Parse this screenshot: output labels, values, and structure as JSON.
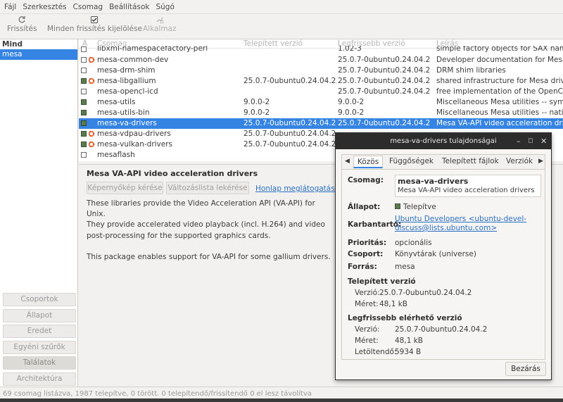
{
  "menubar": [
    "Fájl",
    "Szerkesztés",
    "Csomag",
    "Beállítások",
    "Súgó"
  ],
  "toolbar": {
    "refresh": "Frissítés",
    "mark_all": "Minden frissítés kijelölése",
    "apply": "Alkalmaz"
  },
  "sidebar": {
    "header": "Mind",
    "selected": "mesa",
    "buttons": [
      "Csoportok",
      "Állapot",
      "Eredet",
      "Egyéni szűrők",
      "Találatok",
      "Architektúra"
    ]
  },
  "table": {
    "headers": [
      "Á",
      "Csomag",
      "Telepített verzió",
      "Legfrissebb verzió",
      "Leírás"
    ],
    "rows": [
      {
        "name": "libxml-namespacefactory-perl",
        "installed": "",
        "latest": "1.02-3",
        "desc": "simple factory objects for SAX namespace"
      },
      {
        "name": "mesa-common-dev",
        "installed": "",
        "latest": "25.0.7-0ubuntu0.24.04.2",
        "desc": "Developer documentation for Mesa"
      },
      {
        "name": "mesa-drm-shim",
        "installed": "",
        "latest": "25.0.7-0ubuntu0.24.04.2",
        "desc": "DRM shim libraries"
      },
      {
        "name": "mesa-libgallium",
        "installed": "25.0.7-0ubuntu0.24.04.2",
        "latest": "25.0.7-0ubuntu0.24.04.2",
        "desc": "shared infrastructure for Mesa drivers"
      },
      {
        "name": "mesa-opencl-icd",
        "installed": "",
        "latest": "25.0.7-0ubuntu0.24.04.2",
        "desc": "free implementation of the OpenCL API"
      },
      {
        "name": "mesa-utils",
        "installed": "9.0.0-2",
        "latest": "9.0.0-2",
        "desc": "Miscellaneous Mesa utilities -- symlinks"
      },
      {
        "name": "mesa-utils-bin",
        "installed": "9.0.0-2",
        "latest": "9.0.0-2",
        "desc": "Miscellaneous Mesa utilities -- native app"
      },
      {
        "name": "mesa-va-drivers",
        "installed": "25.0.7-0ubuntu0.24.04.2",
        "latest": "25.0.7-0ubuntu0.24.04.2",
        "desc": "Mesa VA-API video acceleration drivers"
      },
      {
        "name": "mesa-vdpau-drivers",
        "installed": "25.0.7-0ubuntu0.24.04.2",
        "latest": "",
        "desc": ""
      },
      {
        "name": "mesa-vulkan-drivers",
        "installed": "25.0.7-0ubuntu0.24.04.2",
        "latest": "",
        "desc": ""
      },
      {
        "name": "mesaflash",
        "installed": "",
        "latest": "",
        "desc": ""
      }
    ]
  },
  "details": {
    "title": "Mesa VA-API video acceleration drivers",
    "btn_screenshot": "Képernyőkép kérése",
    "btn_changelog": "Változáslista lekérése",
    "homepage": "Honlap meglátogatása",
    "text1": "These libraries provide the Video Acceleration API (VA-API) for Unix.",
    "text2": "They provide accelerated video playback (incl. H.264) and video",
    "text3": "post-processing for the supported graphics cards.",
    "text4": "This package enables support for VA-API for some gallium drivers."
  },
  "status": "69 csomag listázva, 1987 telepítve, 0 törött. 0 telepítendő/frissítendő 0 el lesz távolítva",
  "dialog": {
    "title": "mesa-va-drivers tulajdonságai",
    "tabs": [
      "Közös",
      "Függőségek",
      "Telepített fájlok",
      "Verziók"
    ],
    "package_label": "Csomag:",
    "package_name": "mesa-va-drivers",
    "package_desc": "Mesa VA-API video acceleration drivers",
    "state_label": "Állapot:",
    "state_value": "Telepítve",
    "maint_label": "Karbantartó:",
    "maint_line1": "Ubuntu Developers <ubuntu-devel-",
    "maint_line2": "discuss@lists.ubuntu.com>",
    "priority_label": "Prioritás:",
    "priority_value": "opcionális",
    "section_label": "Csoport:",
    "section_value": "Könyvtárak (universe)",
    "source_label": "Forrás:",
    "source_value": "mesa",
    "installed_header": "Telepített verzió",
    "installed_version_label": "Verzió:",
    "installed_version": "25.0.7-0ubuntu0.24.04.2",
    "installed_size_label": "Méret:",
    "installed_size": "48,1 kB",
    "latest_header": "Legfrissebb elérhető verzió",
    "latest_version_label": "Verzió:",
    "latest_version": "25.0.7-0ubuntu0.24.04.2",
    "latest_size_label": "Méret:",
    "latest_size": "48,1 kB",
    "download_label": "Letöltendő:",
    "download_value": "5934  B",
    "close_btn": "Bezárás"
  }
}
